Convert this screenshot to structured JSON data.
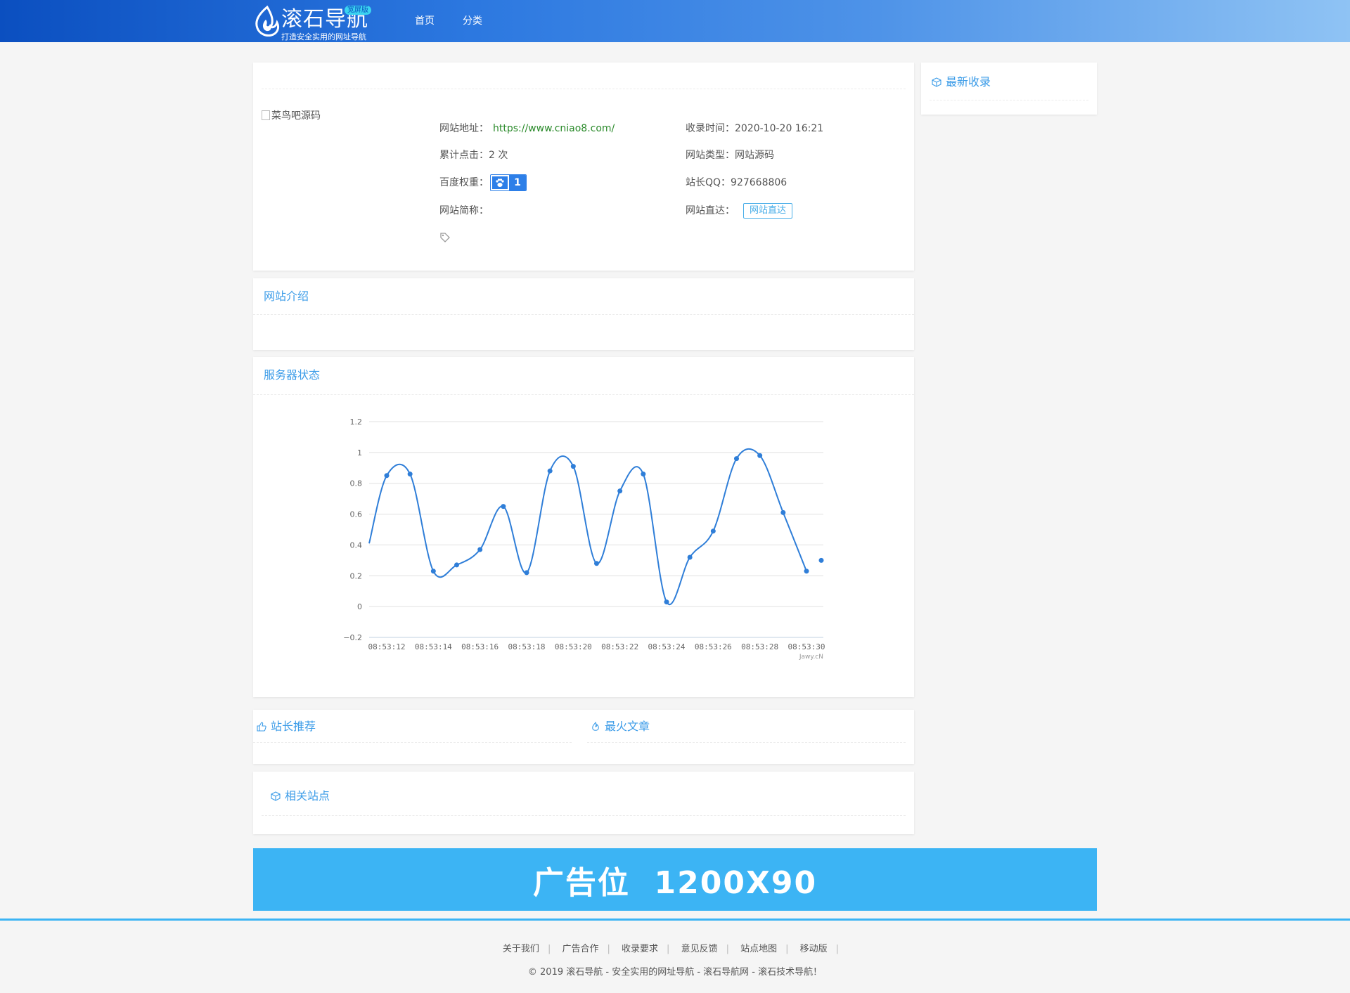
{
  "header": {
    "logo_text": "滚石导航",
    "logo_badge": "宽屏版",
    "logo_slogan": "打造安全实用的网址导航",
    "nav": [
      "首页",
      "分类"
    ]
  },
  "site": {
    "image_alt": "菜鸟吧源码",
    "url_label": "网站地址：",
    "url": "https://www.cniao8.com/",
    "time_label": "收录时间：",
    "time": "2020-10-20 16:21",
    "clicks_label": "累计点击：",
    "clicks": "2 次",
    "type_label": "网站类型：",
    "type": "网站源码",
    "baidu_label": "百度权重：",
    "baidu_weight": "1",
    "qq_label": "站长QQ：",
    "qq": "927668806",
    "short_label": "网站简称：",
    "direct_label": "网站直达：",
    "direct_button": "网站直达"
  },
  "sidebar": {
    "latest_title": "最新收录"
  },
  "sections": {
    "intro_title": "网站介绍",
    "server_title": "服务器状态",
    "recommend_title": "站长推荐",
    "hot_title": "最火文章",
    "related_title": "相关站点"
  },
  "chart_data": {
    "type": "line",
    "x": [
      "08:53:12",
      "08:53:13",
      "08:53:14",
      "08:53:15",
      "08:53:16",
      "08:53:17",
      "08:53:18",
      "08:53:19",
      "08:53:20",
      "08:53:21",
      "08:53:22",
      "08:53:23",
      "08:53:24",
      "08:53:25",
      "08:53:26",
      "08:53:27",
      "08:53:28",
      "08:53:29",
      "08:53:30"
    ],
    "x_tick_labels": [
      "08:53:12",
      "08:53:14",
      "08:53:16",
      "08:53:18",
      "08:53:20",
      "08:53:22",
      "08:53:24",
      "08:53:26",
      "08:53:28",
      "08:53:30"
    ],
    "values": [
      0.85,
      0.86,
      0.23,
      0.27,
      0.37,
      0.65,
      0.22,
      0.88,
      0.91,
      0.28,
      0.75,
      0.86,
      0.03,
      0.32,
      0.49,
      0.96,
      0.98,
      0.61,
      0.23
    ],
    "first_value": 0.41,
    "last_value": 0.3,
    "ylim": [
      -0.2,
      1.2
    ],
    "y_ticks": [
      "1.2",
      "1",
      "0.8",
      "0.6",
      "0.4",
      "0.2",
      "0",
      "−0.2"
    ],
    "credit": "Jawy.cN",
    "line_color": "#2f7ed8",
    "grid": true
  },
  "ad_text": "广告位  1200X90",
  "footer": {
    "links": [
      "关于我们",
      "广告合作",
      "收录要求",
      "意见反馈",
      "站点地图",
      "移动版"
    ],
    "copyright": "© 2019 滚石导航 - 安全实用的网址导航 - 滚石导航网 - 滚石技术导航！"
  }
}
